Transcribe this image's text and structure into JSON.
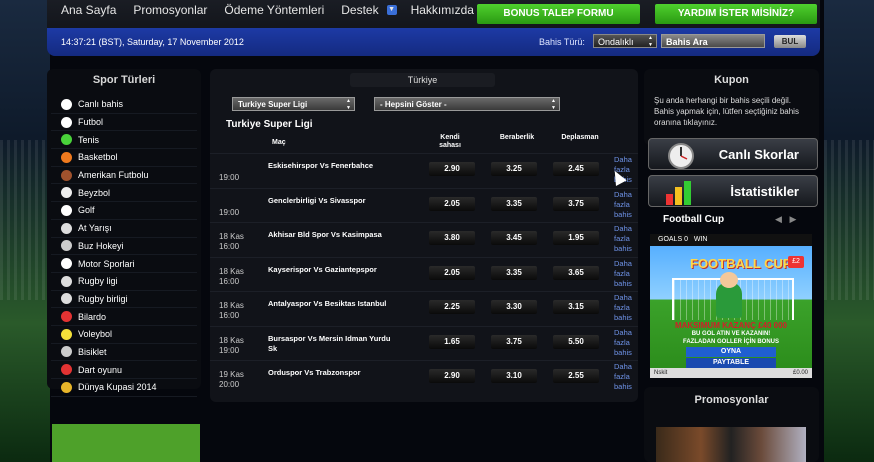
{
  "nav": {
    "items": [
      "Ana Sayfa",
      "Promosyonlar",
      "Ödeme Yöntemleri",
      "Destek",
      "Hakkımızda"
    ],
    "bonus_button": "BONUS TALEP FORMU",
    "help_button": "YARDIM İSTER MİSİNİZ?"
  },
  "infobar": {
    "datetime": "14:37:21 (BST), Saturday, 17 November 2012",
    "bet_type_label": "Bahis Türü:",
    "bet_type_value": "Ondalıklı",
    "search_value": "Bahis Ara",
    "search_button": "BUL"
  },
  "sports": {
    "title": "Spor Türleri",
    "items": [
      {
        "label": "Canlı bahis",
        "icon": "stopwatch-icon",
        "color": "#ffffff"
      },
      {
        "label": "Futbol",
        "icon": "soccer-ball-icon",
        "color": "#ffffff"
      },
      {
        "label": "Tenis",
        "icon": "tennis-ball-icon",
        "color": "#49d23a"
      },
      {
        "label": "Basketbol",
        "icon": "basketball-icon",
        "color": "#f07a1e"
      },
      {
        "label": "Amerikan Futbolu",
        "icon": "american-football-icon",
        "color": "#a0522d"
      },
      {
        "label": "Beyzbol",
        "icon": "baseball-icon",
        "color": "#eeeeee"
      },
      {
        "label": "Golf",
        "icon": "golf-ball-icon",
        "color": "#ffffff"
      },
      {
        "label": "At Yarışı",
        "icon": "horse-icon",
        "color": "#dddddd"
      },
      {
        "label": "Buz Hokeyi",
        "icon": "hockey-stick-icon",
        "color": "#cccccc"
      },
      {
        "label": "Motor Sporlari",
        "icon": "checkered-flag-icon",
        "color": "#ffffff"
      },
      {
        "label": "Rugby ligi",
        "icon": "rugby-ball-icon",
        "color": "#dddddd"
      },
      {
        "label": "Rugby birligi",
        "icon": "rugby-ball-icon",
        "color": "#dddddd"
      },
      {
        "label": "Bilardo",
        "icon": "billiard-ball-icon",
        "color": "#e33333"
      },
      {
        "label": "Voleybol",
        "icon": "volleyball-icon",
        "color": "#f4e13a"
      },
      {
        "label": "Bisiklet",
        "icon": "bicycle-icon",
        "color": "#cccccc"
      },
      {
        "label": "Dart oyunu",
        "icon": "dart-icon",
        "color": "#e33333"
      },
      {
        "label": "Dünya Kupasi 2014",
        "icon": "trophy-icon",
        "color": "#e8b52a"
      }
    ]
  },
  "center": {
    "country_tab": "Türkiye",
    "league_select": "Turkiye Super Ligi",
    "filter_select": "- Hepsini Göster -",
    "league_title": "Turkiye Super Ligi",
    "columns": {
      "match": "Maç",
      "home": "Kendi sahası",
      "draw": "Beraberlik",
      "away": "Deplasman"
    },
    "more_label": "Daha fazla bahis",
    "rows": [
      {
        "date": "",
        "time": "19:00",
        "match": "Eskisehirspor Vs Fenerbahce",
        "home": "2.90",
        "draw": "3.25",
        "away": "2.45"
      },
      {
        "date": "",
        "time": "19:00",
        "match": "Genclerbirligi Vs Sivasspor",
        "home": "2.05",
        "draw": "3.35",
        "away": "3.75"
      },
      {
        "date": "18 Kas",
        "time": "16:00",
        "match": "Akhisar Bld Spor Vs Kasimpasa",
        "home": "3.80",
        "draw": "3.45",
        "away": "1.95"
      },
      {
        "date": "18 Kas",
        "time": "16:00",
        "match": "Kayserispor Vs Gaziantepspor",
        "home": "2.05",
        "draw": "3.35",
        "away": "3.65"
      },
      {
        "date": "18 Kas",
        "time": "16:00",
        "match": "Antalyaspor Vs Besiktas Istanbul",
        "home": "2.25",
        "draw": "3.30",
        "away": "3.15"
      },
      {
        "date": "18 Kas",
        "time": "19:00",
        "match": "Bursaspor Vs Mersin Idman Yurdu Sk",
        "home": "1.65",
        "draw": "3.75",
        "away": "5.50"
      },
      {
        "date": "19 Kas",
        "time": "20:00",
        "match": "Orduspor Vs Trabzonspor",
        "home": "2.90",
        "draw": "3.10",
        "away": "2.55"
      }
    ]
  },
  "kupon": {
    "title": "Kupon",
    "text": "Şu anda herhangi bir bahis seçili değil. Bahis yapmak için, lütfen seçtiğiniz bahis oranına tıklayınız.",
    "live_scores": "Canlı Skorlar",
    "statistics": "İstatistikler"
  },
  "football_cup": {
    "title": "Football Cup",
    "goals_label": "GOALS 0",
    "win_label": "WIN",
    "logo": "FOOTBALL CUP",
    "price": "£2",
    "max_win": "MAKSIMUM KAZANÇ £40 000",
    "line1": "BU GOL ATIN VE KAZANIN!",
    "line2": "FAZLADAN GOLLER İÇİN BONUS",
    "play_button": "OYNA",
    "paytable": "PAYTABLE",
    "footer_left": "Nskit",
    "footer_right": "£0.00"
  },
  "promo": {
    "title": "Promosyonlar"
  }
}
